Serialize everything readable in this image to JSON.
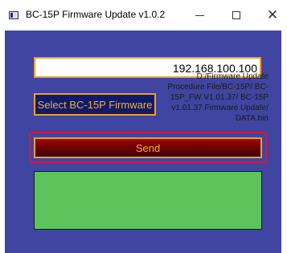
{
  "window": {
    "title": "BC-15P Firmware Update v1.0.2",
    "controls": {
      "minimize": "minimize-icon",
      "maximize": "maximize-icon",
      "close": "close-icon"
    }
  },
  "form": {
    "ip_address": "192.168.100.100",
    "select_button_label": "Select BC-15P Firmware",
    "firmware_path": "D:/Firmware Update Procedure File/BC-15P/ BC-15P_FW V1.01.37/ BC-15P v1.01.37 Firmware Update/ DATA.bin",
    "send_button_label": "Send"
  },
  "colors": {
    "background": "#3f45a0",
    "accent_border": "#f0a020",
    "button_text": "#f5b030",
    "focus_ring": "#d41a3a",
    "status_panel": "#5cc45a"
  }
}
